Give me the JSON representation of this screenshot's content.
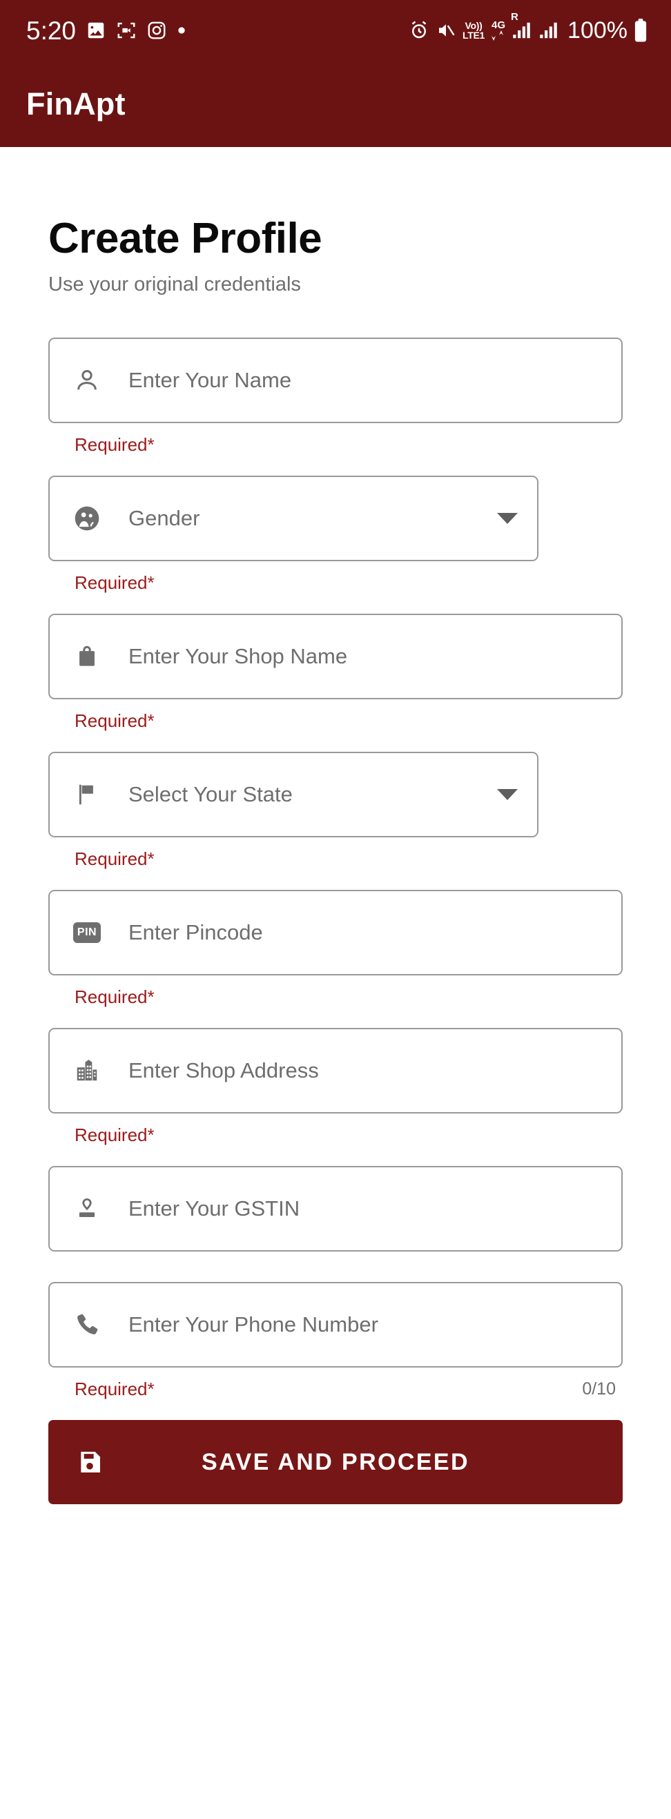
{
  "status_bar": {
    "time": "5:20",
    "left_icons": [
      "photo-icon",
      "screen-record-icon",
      "instagram-icon",
      "dot-icon"
    ],
    "volte_label_top": "Vo))",
    "volte_label_bottom": "LTE1",
    "network_type": "4G",
    "roaming_label": "R",
    "battery_percent": "100%",
    "right_icons": [
      "alarm-icon",
      "mute-icon",
      "volte-icon",
      "data-arrows-icon",
      "signal-sim1-icon",
      "signal-sim2-icon",
      "battery-icon"
    ],
    "background_color": "#6B1313"
  },
  "app_bar": {
    "title": "FinApt",
    "background_color": "#6B1313",
    "title_color": "#FFFFFF"
  },
  "page": {
    "title": "Create Profile",
    "subtitle": "Use your original credentials",
    "required_color": "#9B1B1B",
    "border_color": "#9A9A9A",
    "placeholder_color": "#6E6E6E"
  },
  "form": {
    "fields": [
      {
        "name": "name",
        "icon": "person-icon",
        "placeholder": "Enter Your Name",
        "value": "",
        "type": "text",
        "width": "wide",
        "hint": "Required*",
        "counter": ""
      },
      {
        "name": "gender",
        "icon": "people-icon",
        "placeholder": "Gender",
        "value": "",
        "type": "dropdown",
        "width": "narrow",
        "hint": "Required*",
        "counter": ""
      },
      {
        "name": "shop-name",
        "icon": "shopping-bag-icon",
        "placeholder": "Enter Your Shop Name",
        "value": "",
        "type": "text",
        "width": "wide",
        "hint": "Required*",
        "counter": ""
      },
      {
        "name": "state",
        "icon": "flag-icon",
        "placeholder": "Select Your State",
        "value": "",
        "type": "dropdown",
        "width": "narrow",
        "hint": "Required*",
        "counter": ""
      },
      {
        "name": "pincode",
        "icon": "pin-badge-icon",
        "placeholder": "Enter Pincode",
        "value": "",
        "type": "text",
        "width": "wide",
        "hint": "Required*",
        "counter": ""
      },
      {
        "name": "shop-address",
        "icon": "building-icon",
        "placeholder": "Enter Shop Address",
        "value": "",
        "type": "text",
        "width": "wide",
        "hint": "Required*",
        "counter": ""
      },
      {
        "name": "gstin",
        "icon": "stamp-icon",
        "placeholder": "Enter Your GSTIN",
        "value": "",
        "type": "text",
        "width": "wide",
        "hint": "",
        "counter": ""
      },
      {
        "name": "phone",
        "icon": "phone-icon",
        "placeholder": "Enter Your Phone Number",
        "value": "",
        "type": "text",
        "width": "wide",
        "hint": "Required*",
        "counter": "0/10"
      }
    ],
    "pin_badge_text": "PIN"
  },
  "submit": {
    "label": "SAVE AND PROCEED",
    "icon": "save-floppy-icon",
    "background_color": "#771616",
    "text_color": "#FFFFFF"
  }
}
